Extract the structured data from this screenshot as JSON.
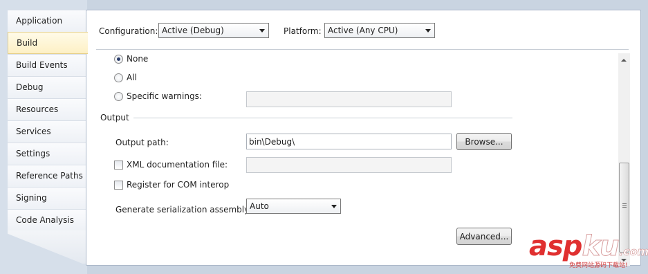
{
  "sidebar": {
    "items": [
      {
        "label": "Application"
      },
      {
        "label": "Build",
        "active": true
      },
      {
        "label": "Build Events"
      },
      {
        "label": "Debug"
      },
      {
        "label": "Resources"
      },
      {
        "label": "Services"
      },
      {
        "label": "Settings"
      },
      {
        "label": "Reference Paths"
      },
      {
        "label": "Signing"
      },
      {
        "label": "Code Analysis"
      }
    ]
  },
  "toolbar": {
    "configuration_label": "Configuration:",
    "configuration_value": "Active (Debug)",
    "platform_label": "Platform:",
    "platform_value": "Active (Any CPU)"
  },
  "warnings": {
    "none_label": "None",
    "all_label": "All",
    "specific_label": "Specific warnings:",
    "selected": "None",
    "specific_value": ""
  },
  "output": {
    "section_label": "Output",
    "output_path_label": "Output path:",
    "output_path_value": "bin\\Debug\\",
    "browse_label": "Browse...",
    "xml_doc_label": "XML documentation file:",
    "xml_doc_value": "",
    "xml_doc_checked": false,
    "com_interop_label": "Register for COM interop",
    "com_interop_checked": false,
    "serialization_label": "Generate serialization assembly:",
    "serialization_value": "Auto",
    "advanced_label": "Advanced..."
  },
  "watermark": {
    "brand_a": "asp",
    "brand_b": "ku",
    "brand_c": ".com",
    "tagline": "免费网站源码下载站!"
  },
  "colors": {
    "background": "#c9d4e1",
    "active_tab": "#fdf0c5",
    "watermark_red": "#e03030"
  }
}
